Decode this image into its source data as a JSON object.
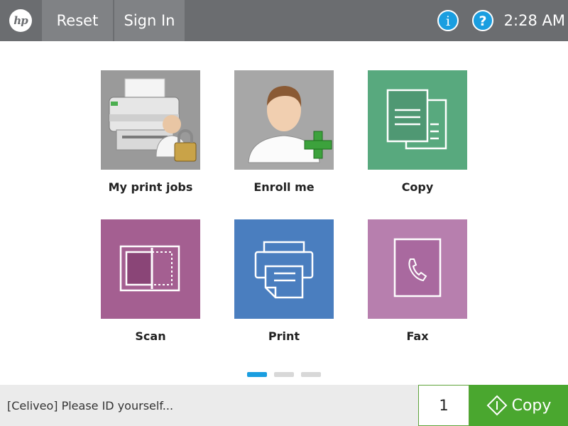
{
  "header": {
    "logo_text": "hp",
    "reset_label": "Reset",
    "signin_label": "Sign In",
    "info_glyph": "i",
    "help_glyph": "?",
    "time": "2:28 AM"
  },
  "apps": [
    {
      "label": "My print jobs",
      "icon": "printer-lock-icon",
      "color": "#9a9a9a"
    },
    {
      "label": "Enroll me",
      "icon": "user-add-icon",
      "color": "#a7a7a7"
    },
    {
      "label": "Copy",
      "icon": "copy-icon",
      "color": "#58a97e"
    },
    {
      "label": "Scan",
      "icon": "scan-icon",
      "color": "#a45f91"
    },
    {
      "label": "Print",
      "icon": "print-icon",
      "color": "#4a7ebf"
    },
    {
      "label": "Fax",
      "icon": "fax-icon",
      "color": "#b77fae"
    }
  ],
  "pager": {
    "pages": 3,
    "active": 1,
    "active_color": "#1a9ee0"
  },
  "footer": {
    "status": "[Celiveo] Please ID yourself...",
    "copies": "1",
    "start_label": "Copy",
    "start_color": "#4aa72f"
  }
}
